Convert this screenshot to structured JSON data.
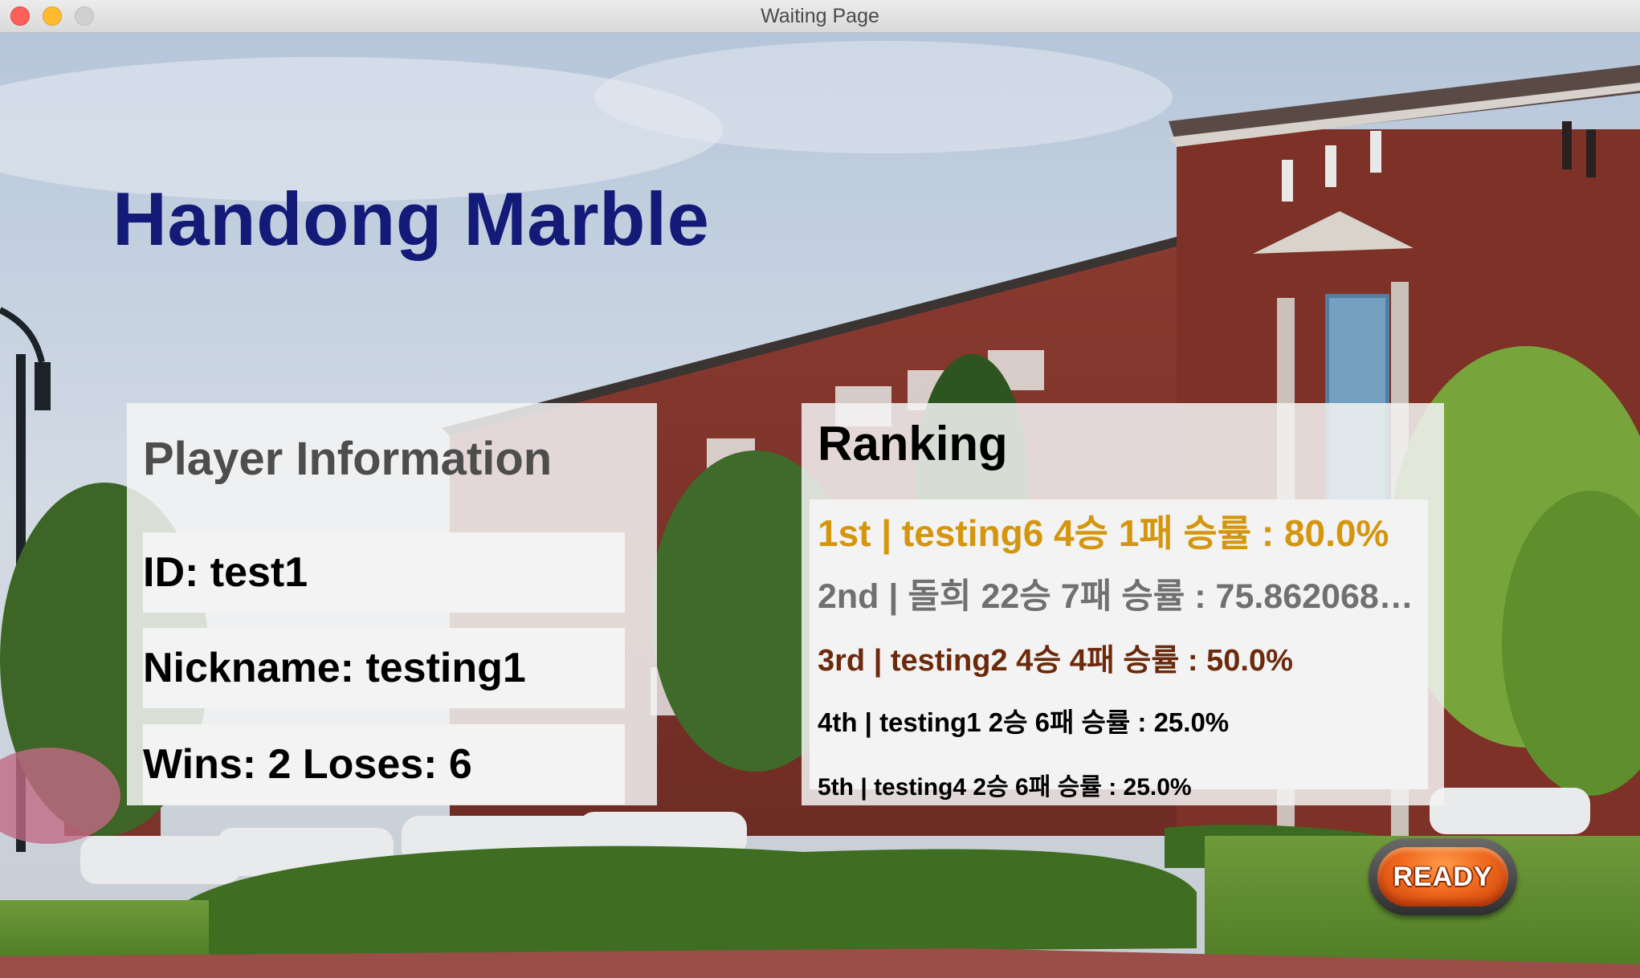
{
  "window": {
    "title": "Waiting Page"
  },
  "app_title": "Handong Marble",
  "player_info": {
    "heading": "Player Information",
    "id_text": "ID: test1",
    "nickname_text": "Nickname: testing1",
    "record_text": "Wins: 2 Loses: 6"
  },
  "ranking": {
    "heading": "Ranking",
    "items": [
      {
        "text": "1st | testing6 4승 1패 승률 : 80.0%",
        "color": "#d4960e"
      },
      {
        "text": "2nd | 돌희 22승 7패 승률 : 75.8620689...",
        "color": "#707070"
      },
      {
        "text": "3rd | testing2 4승 4패 승률 : 50.0%",
        "color": "#6b2a0c"
      },
      {
        "text": "4th | testing1 2승 6패 승률 : 25.0%",
        "color": "#000000"
      },
      {
        "text": "5th | testing4 2승 6패 승률 : 25.0%",
        "color": "#000000"
      }
    ]
  },
  "ready_button": {
    "label": "READY"
  },
  "colors": {
    "title": "#141a77",
    "panel_heading": "#4d4d4d",
    "ready_orange": "#f06a1e"
  }
}
